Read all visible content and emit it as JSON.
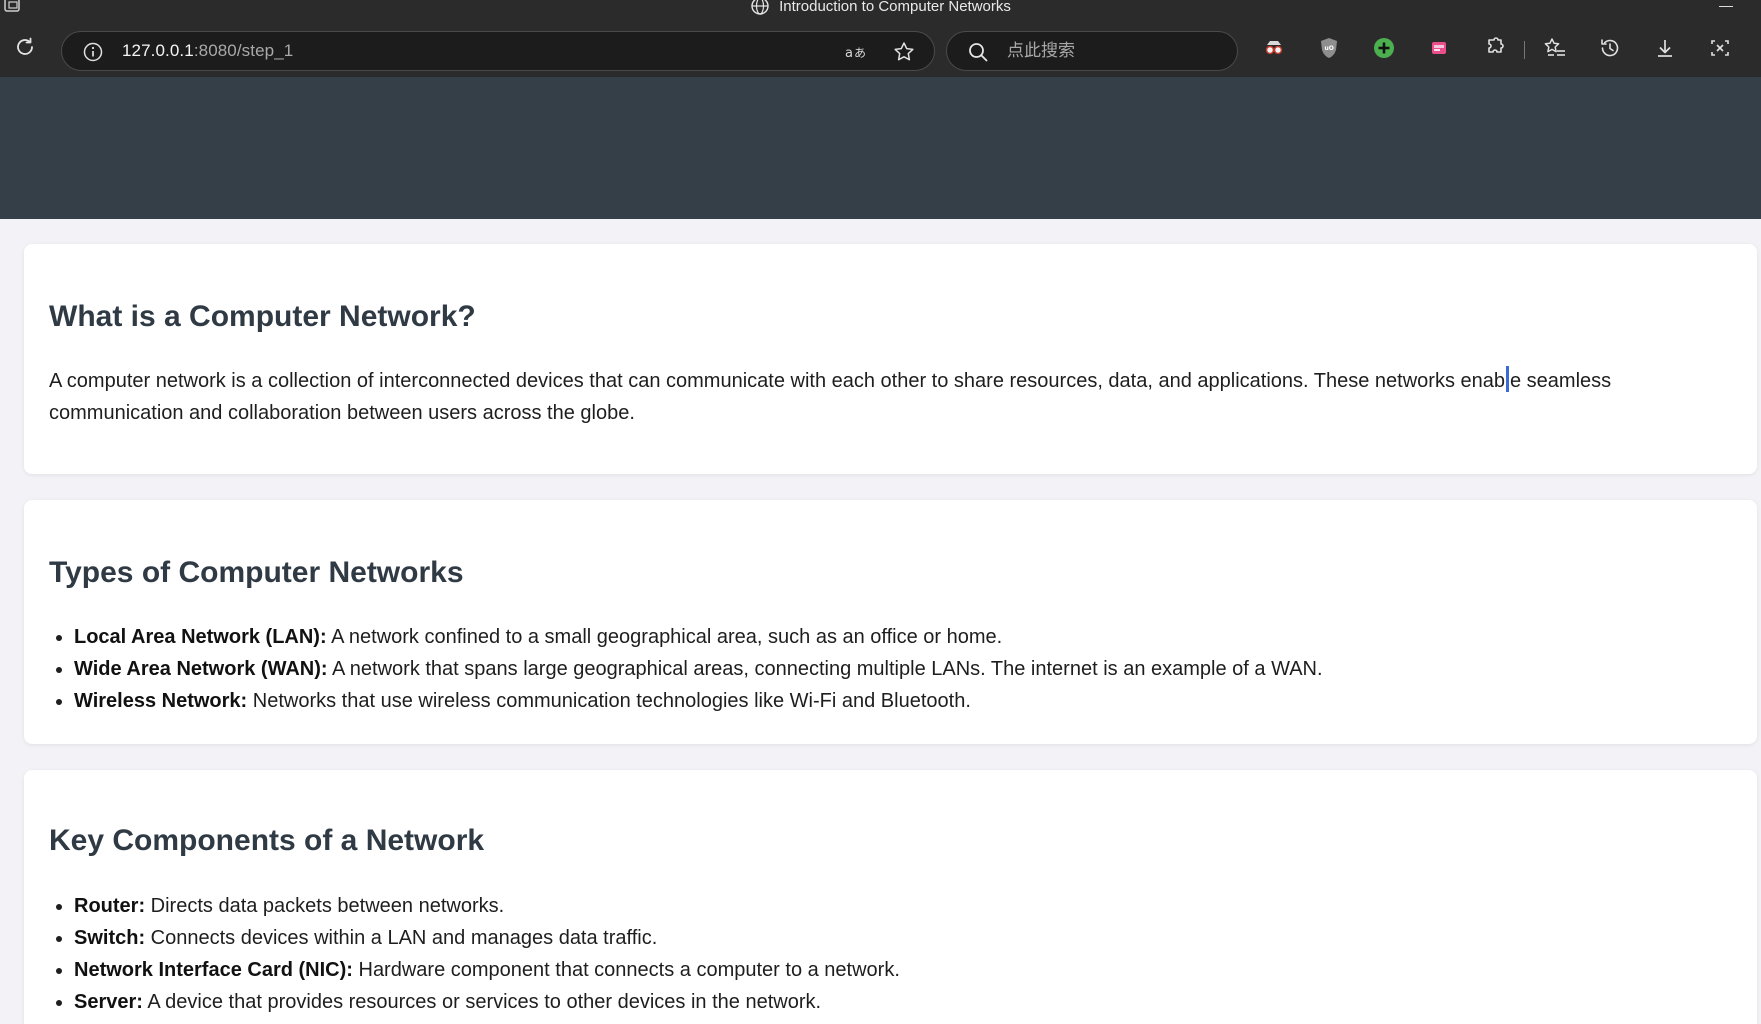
{
  "browser": {
    "window_title": "Introduction to Computer Networks",
    "url_host": "127.0.0.1",
    "url_path": ":8080/step_1",
    "search_placeholder": "点此搜索"
  },
  "icons": {
    "app": "app-window-icon",
    "tab_favicon": "globe-icon",
    "reload": "reload-icon",
    "site_info": "info-icon",
    "translate": "translate-icon",
    "favorite": "star-icon",
    "search": "search-icon",
    "extensions": [
      "spy-glasses-extension-icon",
      "ublock-shield-icon",
      "green-plus-extension-icon",
      "pink-extension-icon",
      "puzzle-extensions-icon"
    ],
    "toolbar_right": [
      "favorites-icon",
      "history-icon",
      "download-icon",
      "screenshot-icon"
    ]
  },
  "sections": [
    {
      "heading": "What is a Computer Network?",
      "paragraph_before_caret": "A computer network is a collection of interconnected devices that can communicate with each other to share resources, data, and applications. These networks enab",
      "paragraph_after_caret": "e seamless communication and collaboration between users across the globe."
    },
    {
      "heading": "Types of Computer Networks",
      "items": [
        {
          "term": "Local Area Network (LAN):",
          "desc": " A network confined to a small geographical area, such as an office or home."
        },
        {
          "term": "Wide Area Network (WAN):",
          "desc": " A network that spans large geographical areas, connecting multiple LANs. The internet is an example of a WAN."
        },
        {
          "term": "Wireless Network:",
          "desc": " Networks that use wireless communication technologies like Wi-Fi and Bluetooth."
        }
      ]
    },
    {
      "heading": "Key Components of a Network",
      "items": [
        {
          "term": "Router:",
          "desc": " Directs data packets between networks."
        },
        {
          "term": "Switch:",
          "desc": " Connects devices within a LAN and manages data traffic."
        },
        {
          "term": "Network Interface Card (NIC):",
          "desc": " Hardware component that connects a computer to a network."
        },
        {
          "term": "Server:",
          "desc": " A device that provides resources or services to other devices in the network."
        }
      ]
    }
  ]
}
